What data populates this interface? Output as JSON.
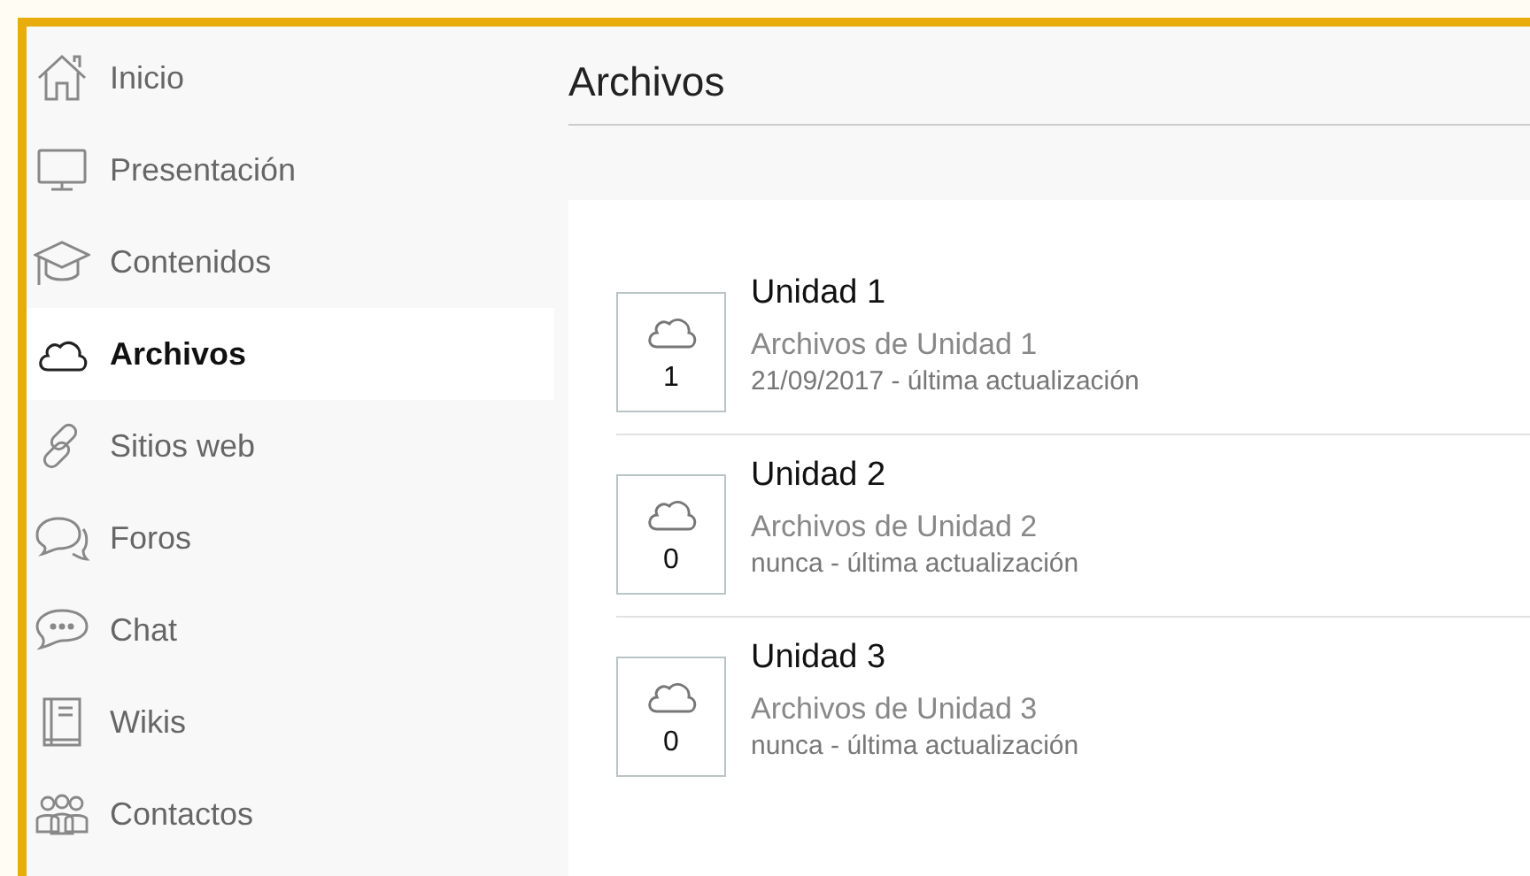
{
  "sidebar": {
    "items": [
      {
        "label": "Inicio",
        "kind": "home",
        "selected": false
      },
      {
        "label": "Presentación",
        "kind": "monitor",
        "selected": false
      },
      {
        "label": "Contenidos",
        "kind": "cap",
        "selected": false
      },
      {
        "label": "Archivos",
        "kind": "cloud",
        "selected": true
      },
      {
        "label": "Sitios web",
        "kind": "link",
        "selected": false
      },
      {
        "label": "Foros",
        "kind": "forum",
        "selected": false
      },
      {
        "label": "Chat",
        "kind": "chat",
        "selected": false
      },
      {
        "label": "Wikis",
        "kind": "book",
        "selected": false
      },
      {
        "label": "Contactos",
        "kind": "people",
        "selected": false
      }
    ]
  },
  "main": {
    "title": "Archivos",
    "folders": [
      {
        "count": "1",
        "title": "Unidad 1",
        "description": "Archivos de Unidad 1",
        "updated": "21/09/2017 - última actualización"
      },
      {
        "count": "0",
        "title": "Unidad 2",
        "description": "Archivos de Unidad 2",
        "updated": "nunca - última actualización"
      },
      {
        "count": "0",
        "title": "Unidad 3",
        "description": "Archivos de Unidad 3",
        "updated": "nunca - última actualización"
      }
    ]
  }
}
